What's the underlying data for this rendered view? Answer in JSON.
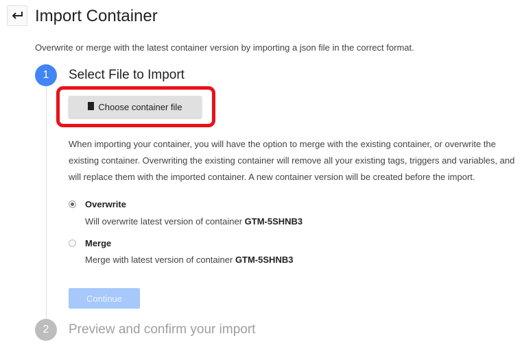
{
  "header": {
    "back_icon": "back-arrow-icon",
    "title": "Import Container"
  },
  "description": "Overwrite or merge with the latest container version by importing a json file in the correct format.",
  "steps": [
    {
      "number": "1",
      "title": "Select File to Import",
      "state": "active",
      "color": "#4285f4"
    },
    {
      "number": "2",
      "title": "Preview and confirm your import",
      "state": "inactive",
      "color": "#bdbdbd"
    }
  ],
  "file_button": {
    "icon": "file-icon",
    "label": "Choose container file"
  },
  "highlight_color": "#e8121b",
  "info_text": "When importing your container, you will have the option to merge with the existing container, or overwrite the existing container. Overwriting the existing container will remove all your existing tags, triggers and variables, and will replace them with the imported container. A new container version will be created before the import.",
  "options": [
    {
      "label": "Overwrite",
      "selected": true,
      "desc_prefix": "Will overwrite latest version of container ",
      "container_id": "GTM-5SHNB3"
    },
    {
      "label": "Merge",
      "selected": false,
      "desc_prefix": "Merge with latest version of container ",
      "container_id": "GTM-5SHNB3"
    }
  ],
  "continue_button": {
    "label": "Continue",
    "disabled": true,
    "color": "#a6c8fb"
  }
}
